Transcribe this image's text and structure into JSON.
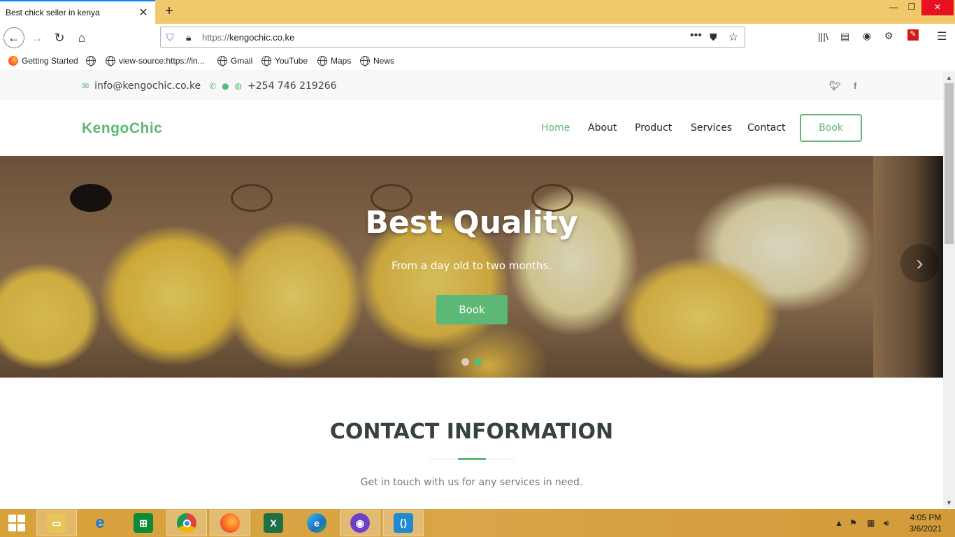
{
  "browser": {
    "tab_title": "Best chick seller in kenya",
    "url_proto": "https://",
    "url_host": "kengochic.co.ke",
    "bookmarks": [
      "Getting Started",
      "view-source:https://in...",
      "Gmail",
      "YouTube",
      "Maps",
      "News"
    ]
  },
  "site": {
    "email": "info@kengochic.co.ke",
    "phone": "+254 746 219266",
    "logo": "KengoChic",
    "menu": [
      "Home",
      "About",
      "Product",
      "Services",
      "Contact"
    ],
    "book_label": "Book",
    "hero": {
      "title": "Best Quality",
      "subtitle": "From a day old to two months.",
      "button": "Book",
      "slides": 2,
      "active_slide": 2
    },
    "section": {
      "title": "CONTACT INFORMATION",
      "subtitle": "Get in touch with us for any services in need."
    },
    "accent_color": "#5cb874"
  },
  "taskbar": {
    "time": "4:05 PM",
    "date": "3/6/2021"
  }
}
